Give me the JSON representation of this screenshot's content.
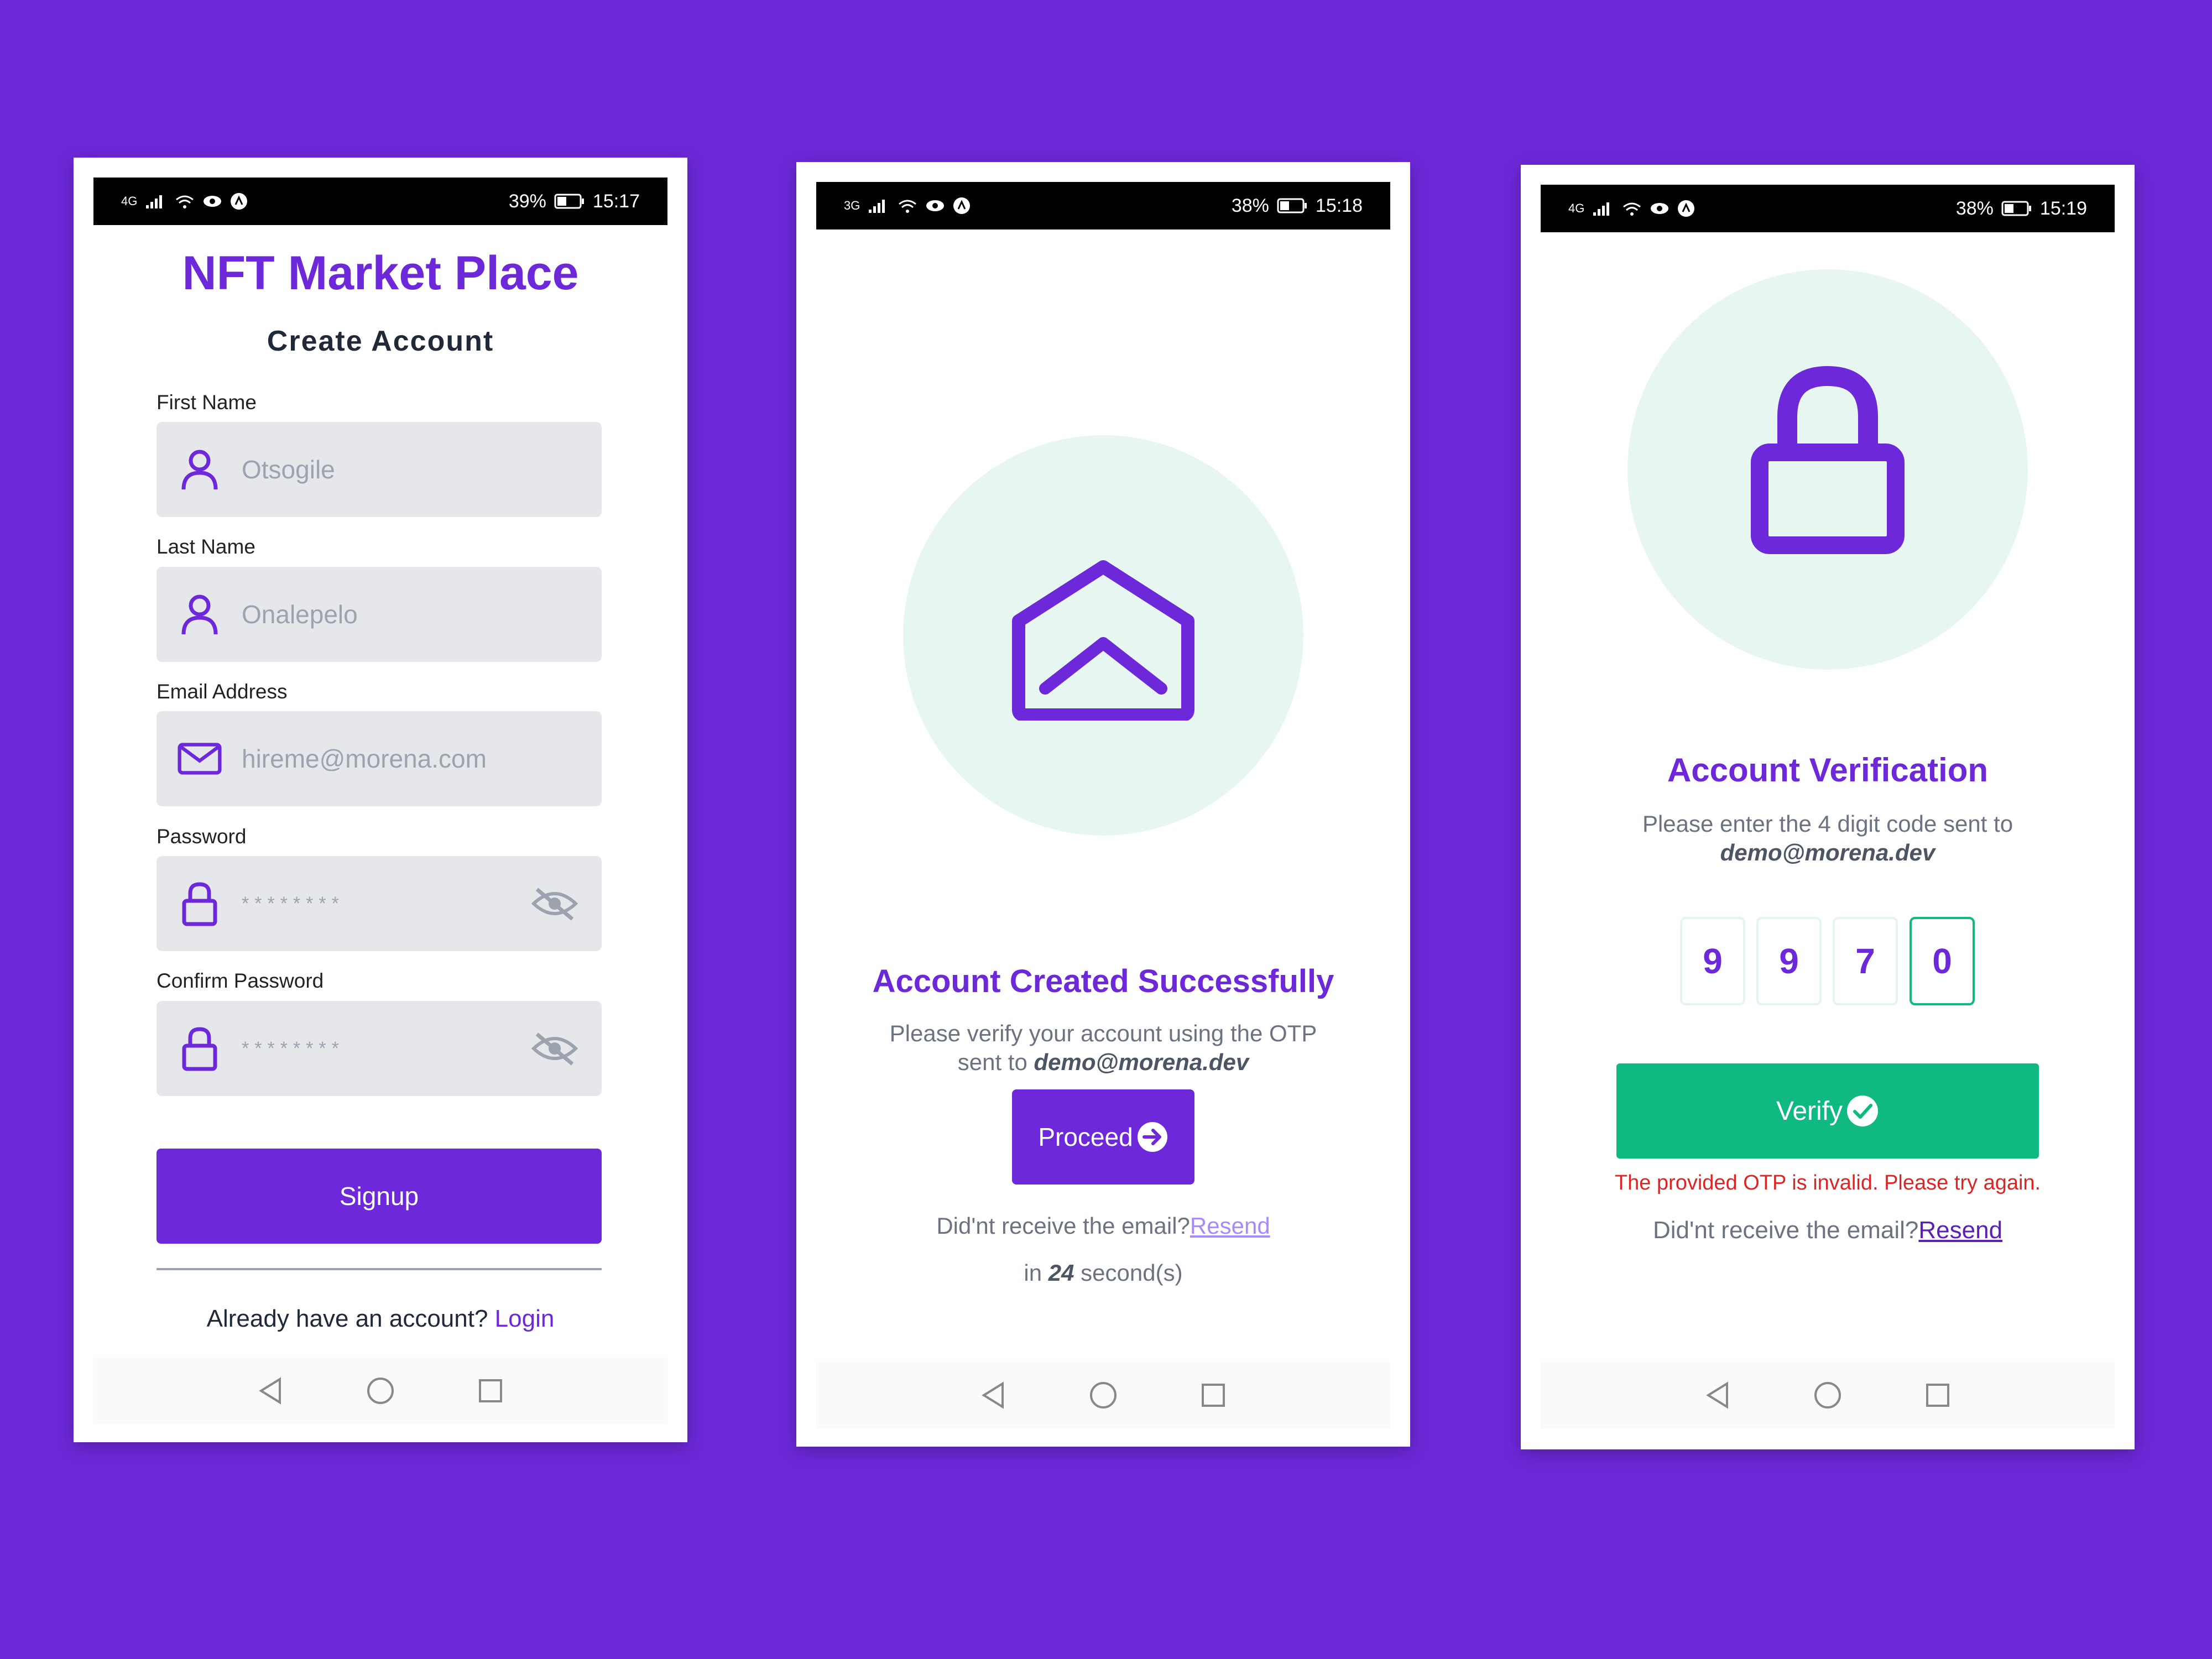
{
  "screens": {
    "signup": {
      "status": {
        "battery": "39%",
        "time": "15:17",
        "network": "4G"
      },
      "app_title": "NFT Market Place",
      "subtitle": "Create Account",
      "fields": [
        {
          "label": "First Name",
          "placeholder": "Otsogile",
          "icon": "user-icon"
        },
        {
          "label": "Last Name",
          "placeholder": "Onalepelo",
          "icon": "user-icon"
        },
        {
          "label": "Email Address",
          "placeholder": "hireme@morena.com",
          "icon": "mail-icon"
        },
        {
          "label": "Password",
          "placeholder": "********",
          "icon": "lock-icon"
        },
        {
          "label": "Confirm Password",
          "placeholder": "********",
          "icon": "lock-icon"
        }
      ],
      "signup_button": "Signup",
      "footer_text": "Already have an account?",
      "login_link": "Login"
    },
    "created": {
      "status": {
        "battery": "38%",
        "time": "15:18",
        "network": "3G"
      },
      "title": "Account Created Successfully",
      "message_line1": "Please verify your account using the OTP",
      "message_prefix": "sent to",
      "email": "demo@morena.dev",
      "proceed_button": "Proceed",
      "resend_prompt": "Did'nt receive the email?",
      "resend_link": "Resend",
      "countdown_prefix": "in",
      "countdown_value": "24",
      "countdown_suffix": "second(s)"
    },
    "verification": {
      "status": {
        "battery": "38%",
        "time": "15:19",
        "network": "4G"
      },
      "title": "Account Verification",
      "message": "Please enter the 4 digit code sent to",
      "email": "demo@morena.dev",
      "otp_digits": [
        "9",
        "9",
        "7",
        "0"
      ],
      "verify_button": "Verify",
      "error_message": "The provided OTP is invalid. Please try again.",
      "resend_prompt": "Did'nt receive the email?",
      "resend_link": "Resend"
    }
  },
  "colors": {
    "background": "#6d28d9",
    "primary": "#6d28d9",
    "success": "#10b981",
    "error": "#dc2626",
    "circle_bg": "#e8f6f1"
  }
}
